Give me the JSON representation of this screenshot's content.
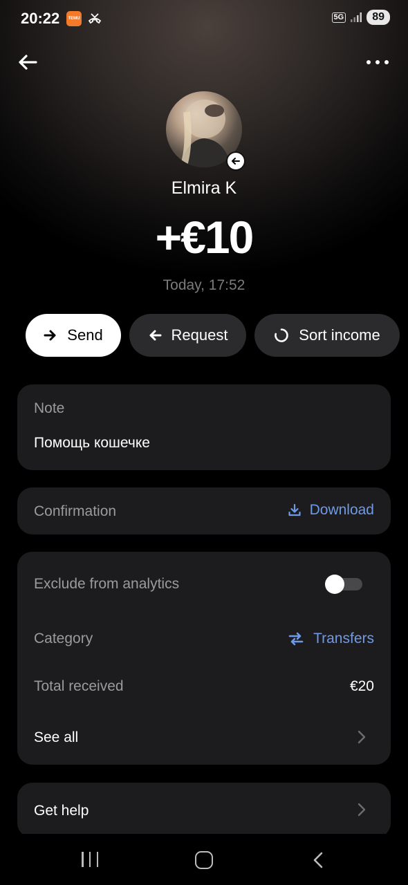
{
  "status_bar": {
    "time": "20:22",
    "temu_icon_text": "TEMU",
    "network": "5G",
    "battery": "89"
  },
  "header": {
    "back_icon": "arrow-left-icon",
    "more_icon": "more-horizontal-icon"
  },
  "transaction": {
    "contact_name": "Elmira K",
    "amount": "+€10",
    "date": "Today, 17:52"
  },
  "actions": [
    {
      "label": "Send",
      "icon": "arrow-right-icon"
    },
    {
      "label": "Request",
      "icon": "arrow-left-icon"
    },
    {
      "label": "Sort income",
      "icon": "refresh-icon"
    }
  ],
  "note": {
    "label": "Note",
    "value": "Помощь кошечке"
  },
  "confirmation": {
    "label": "Confirmation",
    "download_label": "Download"
  },
  "details": {
    "exclude_label": "Exclude from analytics",
    "exclude_enabled": false,
    "category_label": "Category",
    "category_value": "Transfers",
    "total_label": "Total received",
    "total_value": "€20",
    "see_all_label": "See all"
  },
  "help": {
    "label": "Get help"
  },
  "colors": {
    "accent_blue": "#6e9ae8",
    "card_bg": "#1c1c1e",
    "muted_text": "#9b9b9e"
  }
}
